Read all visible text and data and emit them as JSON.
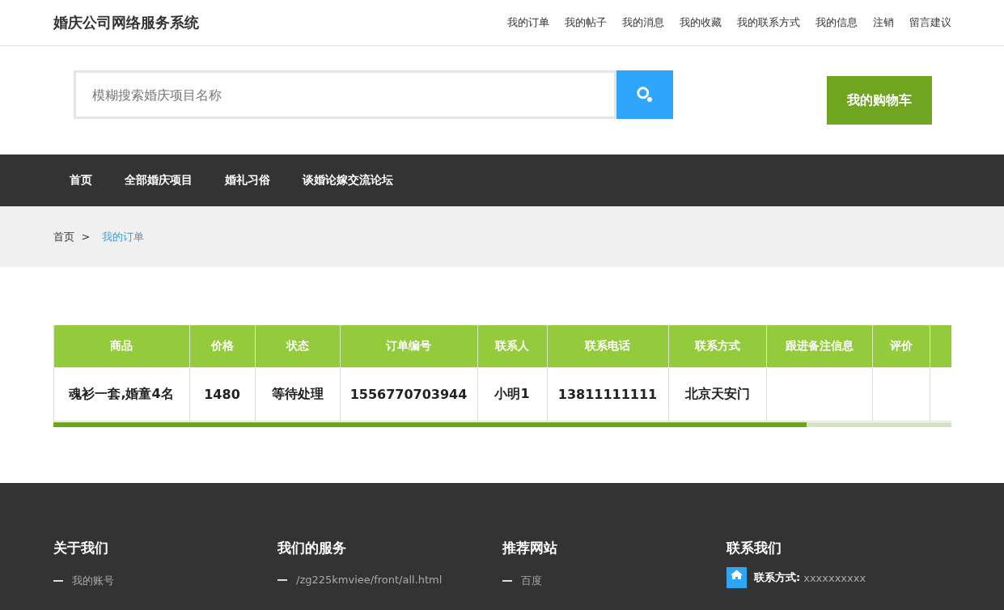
{
  "header": {
    "title": "婚庆公司网络服务系统",
    "links": [
      "我的订单",
      "我的帖子",
      "我的消息",
      "我的收藏",
      "我的联系方式",
      "我的信息",
      "注销",
      "留言建议"
    ]
  },
  "search": {
    "placeholder": "模糊搜索婚庆项目名称"
  },
  "cart_button": {
    "label": "我的购物车"
  },
  "nav": {
    "items": [
      "首页",
      "全部婚庆项目",
      "婚礼习俗",
      "谈婚论嫁交流论坛"
    ]
  },
  "breadcrumb": {
    "separator": ">",
    "items": [
      {
        "label": "首页",
        "current": false
      },
      {
        "label": "我的订单",
        "current": true
      }
    ]
  },
  "table": {
    "columns": [
      "商品",
      "价格",
      "状态",
      "订单编号",
      "联系人",
      "联系电话",
      "联系方式",
      "跟进备注信息",
      "评价"
    ],
    "rows": [
      {
        "cells": [
          "魂衫一套,婚童4名",
          "1480",
          "等待处理",
          "1556770703944",
          "小明1",
          "13811111111",
          "北京天安门"
        ]
      }
    ]
  },
  "footer": {
    "columns": [
      {
        "kind": "links",
        "heading": "关于我们",
        "items": [
          {
            "text": "我的账号"
          }
        ]
      },
      {
        "kind": "links",
        "heading": "我们的服务",
        "items": [
          {
            "text": "/zg225kmviee/front/all.html"
          }
        ]
      },
      {
        "kind": "links",
        "heading": "推荐网站",
        "items": [
          {
            "text": "百度"
          }
        ]
      },
      {
        "kind": "contact",
        "heading": "联系我们",
        "items": [
          {
            "label": "联系方式:",
            "value": "xxxxxxxxxx"
          }
        ]
      }
    ]
  }
}
